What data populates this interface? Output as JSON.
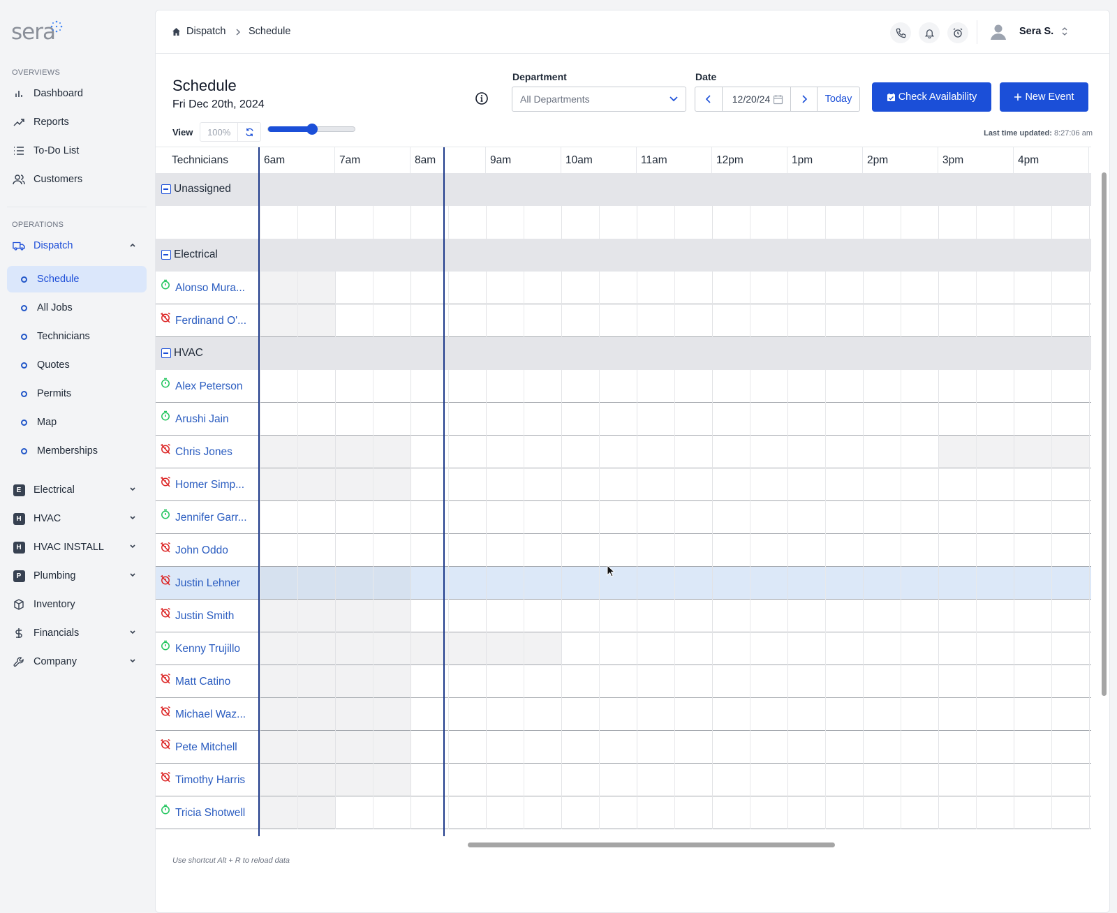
{
  "brand": {
    "logo_text": "sera",
    "accent": "#1b4fd8"
  },
  "sidebar": {
    "overviews_label": "OVERVIEWS",
    "operations_label": "OPERATIONS",
    "overviews": [
      {
        "label": "Dashboard",
        "icon": "bar-chart-icon"
      },
      {
        "label": "Reports",
        "icon": "trend-icon"
      },
      {
        "label": "To-Do List",
        "icon": "list-icon"
      },
      {
        "label": "Customers",
        "icon": "users-icon"
      }
    ],
    "dispatch": {
      "label": "Dispatch",
      "icon": "truck-icon",
      "expanded": true
    },
    "dispatch_items": [
      "Schedule",
      "All Jobs",
      "Technicians",
      "Quotes",
      "Permits",
      "Map",
      "Memberships"
    ],
    "active_item": "Schedule",
    "departments": [
      {
        "badge": "E",
        "label": "Electrical"
      },
      {
        "badge": "H",
        "label": "HVAC"
      },
      {
        "badge": "H",
        "label": "HVAC INSTALL"
      },
      {
        "badge": "P",
        "label": "Plumbing"
      }
    ],
    "inventory": "Inventory",
    "financials": "Financials",
    "company": "Company"
  },
  "topbar": {
    "breadcrumb": [
      "Dispatch",
      "Schedule"
    ],
    "user_name": "Sera S."
  },
  "header": {
    "title": "Schedule",
    "date": "Fri Dec 20th, 2024",
    "department_label": "Department",
    "department_value": "All Departments",
    "date_label": "Date",
    "date_value": "12/20/24",
    "today_label": "Today",
    "check_availability": "Check Availability",
    "new_event": "New Event",
    "view_label": "View",
    "zoom": "100%",
    "zoom_slider_fraction": 0.5,
    "last_updated_label": "Last time updated:",
    "last_updated_value": "8:27:06 am"
  },
  "grid": {
    "tech_header": "Technicians",
    "hours": [
      "6am",
      "7am",
      "8am",
      "9am",
      "10am",
      "11am",
      "12pm",
      "1pm",
      "2pm",
      "3pm",
      "4pm"
    ],
    "groups": [
      {
        "name": "Unassigned",
        "techs": [
          {
            "name": "",
            "status": "none",
            "blank": true
          }
        ]
      },
      {
        "name": "Electrical",
        "techs": [
          {
            "name": "Alonso Mura...",
            "status": "on",
            "unavail": [
              [
                0,
                2
              ]
            ]
          },
          {
            "name": "Ferdinand O'...",
            "status": "off",
            "unavail": [
              [
                0,
                2
              ]
            ]
          }
        ]
      },
      {
        "name": "HVAC",
        "techs": [
          {
            "name": "Alex Peterson",
            "status": "on",
            "unavail": []
          },
          {
            "name": "Arushi Jain",
            "status": "on",
            "unavail": []
          },
          {
            "name": "Chris Jones",
            "status": "off",
            "unavail": [
              [
                0,
                4
              ],
              [
                18,
                22
              ]
            ]
          },
          {
            "name": "Homer Simp...",
            "status": "off",
            "unavail": [
              [
                0,
                4
              ]
            ]
          },
          {
            "name": "Jennifer Garr...",
            "status": "on",
            "unavail": []
          },
          {
            "name": "John Oddo",
            "status": "off",
            "unavail": []
          },
          {
            "name": "Justin Lehner",
            "status": "off",
            "unavail": [
              [
                0,
                4
              ]
            ],
            "highlight": true
          },
          {
            "name": "Justin Smith",
            "status": "off",
            "unavail": [
              [
                0,
                4
              ]
            ]
          },
          {
            "name": "Kenny Trujillo",
            "status": "on",
            "unavail": [
              [
                0,
                8
              ]
            ]
          },
          {
            "name": "Matt Catino",
            "status": "off",
            "unavail": [
              [
                0,
                4
              ]
            ]
          },
          {
            "name": "Michael Waz...",
            "status": "off",
            "unavail": [
              [
                0,
                4
              ]
            ]
          },
          {
            "name": "Pete Mitchell",
            "status": "off",
            "unavail": [
              [
                0,
                4
              ]
            ]
          },
          {
            "name": "Timothy Harris",
            "status": "off",
            "unavail": [
              [
                0,
                4
              ]
            ]
          },
          {
            "name": "Tricia Shotwell",
            "status": "on",
            "unavail": [
              [
                0,
                2
              ]
            ]
          }
        ]
      }
    ],
    "colors": {
      "on": "#22c55e",
      "off": "#dc2626",
      "now_line": "#1e3a8a"
    }
  },
  "footer_note": "Use shortcut Alt + R to reload data"
}
